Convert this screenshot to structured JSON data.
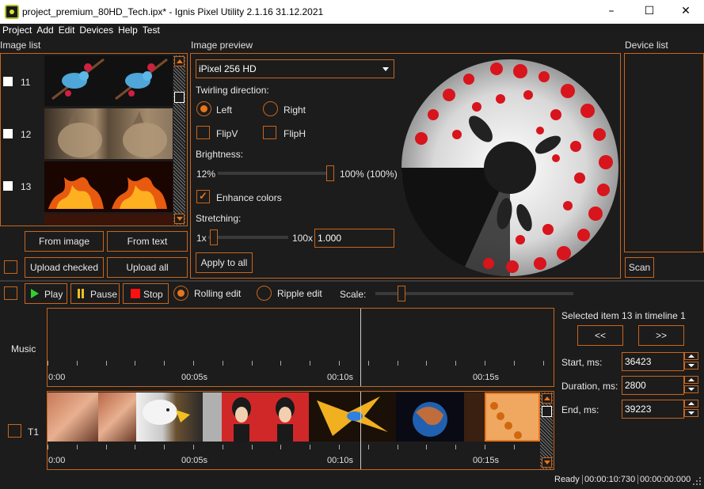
{
  "window": {
    "title": "project_premium_80HD_Tech.ipx* - Ignis Pixel Utility 2.1.16 31.12.2021",
    "controls": [
      "–",
      "☐",
      "✕"
    ]
  },
  "menu": [
    "Project",
    "Add",
    "Edit",
    "Devices",
    "Help",
    "Test"
  ],
  "image_list": {
    "label": "Image list",
    "items": [
      {
        "number": "11",
        "thumb": "birds-on-branch"
      },
      {
        "number": "12",
        "thumb": "cat"
      },
      {
        "number": "13",
        "thumb": "fire-dragon"
      }
    ],
    "buttons": {
      "from_image": "From image",
      "from_text": "From text",
      "upload_checked": "Upload checked",
      "upload_all": "Upload all"
    }
  },
  "preview": {
    "label": "Image preview",
    "device_select": "iPixel 256 HD",
    "twirling_label": "Twirling direction:",
    "left": "Left",
    "right": "Right",
    "flipv": "FlipV",
    "fliph": "FlipH",
    "brightness_label": "Brightness:",
    "brightness_min": "12%",
    "brightness_max": "100% (100%)",
    "brightness_level": 1.0,
    "enhance_colors": "Enhance colors",
    "stretching_label": "Stretching:",
    "stretch_min": "1x",
    "stretch_max": "100x",
    "stretch_value": "1.000",
    "stretch_level": 0.0,
    "apply_all": "Apply to all"
  },
  "device_list": {
    "label": "Device list",
    "scan": "Scan"
  },
  "transport": {
    "play": "Play",
    "pause": "Pause",
    "stop": "Stop",
    "rolling_edit": "Rolling edit",
    "ripple_edit": "Ripple edit",
    "scale_label": "Scale:"
  },
  "timeline": {
    "music_label": "Music",
    "track_label": "T1",
    "ticks": [
      "0:00",
      "00:05s",
      "00:10s",
      "00:15s"
    ],
    "clips": [
      "woman-portrait",
      "woman-portrait",
      "eagle",
      "eagle",
      "pinup-girl",
      "pinup-girl",
      "parrot",
      "planet",
      "planet",
      "coins"
    ]
  },
  "side": {
    "selected_text": "Selected item 13 in timeline 1",
    "prev": "<<",
    "next": ">>",
    "start_label": "Start, ms:",
    "start_value": "36423",
    "duration_label": "Duration, ms:",
    "duration_value": "2800",
    "end_label": "End, ms:",
    "end_value": "39223"
  },
  "status": {
    "state": "Ready",
    "time1": "00:00:10:730",
    "time2": "00:00:00:000"
  },
  "colors": {
    "accent": "#e8751c",
    "border": "#c8651c",
    "background": "#1c1c1c"
  }
}
